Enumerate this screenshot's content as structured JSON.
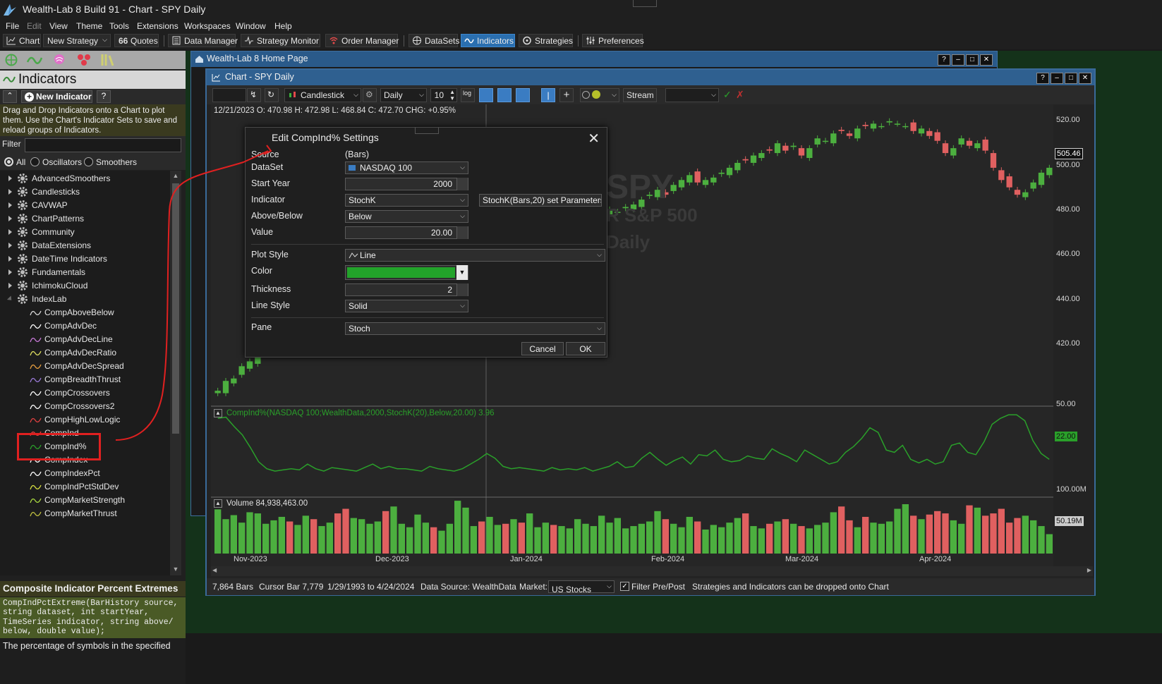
{
  "app": {
    "title": "Wealth-Lab 8 Build 91 - Chart - SPY Daily"
  },
  "menu": [
    "File",
    "Edit",
    "View",
    "Theme",
    "Tools",
    "Extensions",
    "Workspaces",
    "Window",
    "Help"
  ],
  "toolbar": {
    "chart": "Chart",
    "new_strategy": "New Strategy",
    "quotes": "Quotes",
    "data_manager": "Data Manager",
    "strategy_monitor": "Strategy Monitor",
    "order_manager": "Order Manager",
    "datasets": "DataSets",
    "indicators": "Indicators",
    "strategies": "Strategies",
    "preferences": "Preferences"
  },
  "left": {
    "title": "Indicators",
    "new_indicator": "New Indicator",
    "help_btn": "?",
    "help_text": "Drag and Drop Indicators onto a Chart to plot them. Use the Chart's Indicator Sets to save and reload groups of Indicators.",
    "filter_label": "Filter",
    "radios": [
      "All",
      "Oscillators",
      "Smoothers"
    ],
    "groups": [
      "AdvancedSmoothers",
      "Candlesticks",
      "CAVWAP",
      "ChartPatterns",
      "Community",
      "DataExtensions",
      "DateTime Indicators",
      "Fundamentals",
      "IchimokuCloud",
      "IndexLab"
    ],
    "children": [
      "CompAboveBelow",
      "CompAdvDec",
      "CompAdvDecLine",
      "CompAdvDecRatio",
      "CompAdvDecSpread",
      "CompBreadthThrust",
      "CompCrossovers",
      "CompCrossovers2",
      "CompHighLowLogic",
      "CompInd",
      "CompInd%",
      "CompIndex",
      "CompIndexPct",
      "CompIndPctStdDev",
      "CompMarketStrength",
      "CompMarketThrust"
    ],
    "child_colors": [
      "#d8d8d8",
      "#ffffff",
      "#c879d8",
      "#e0e060",
      "#e8a040",
      "#9a7ad8",
      "#ffffff",
      "#ffffff",
      "#e04040",
      "#e04040",
      "#2aa02a",
      "#ffffff",
      "#ffffff",
      "#d8e040",
      "#a8d840",
      "#c0c040"
    ],
    "desc_title": "Composite Indicator Percent Extremes",
    "desc_sig": "CompIndPctExtreme(BarHistory source,\nstring dataset, int startYear,\nTimeSeries indicator, string above/\nbelow, double value);",
    "desc_text": "The percentage of symbols in the specified"
  },
  "home": {
    "title": "Wealth-Lab 8 Home Page",
    "help": "?"
  },
  "chart": {
    "title": "Chart - SPY Daily",
    "help": "?",
    "style": "Candlestick",
    "scale": "Daily",
    "bars": "10",
    "stream": "Stream",
    "ohlc": "12/21/2023 O: 470.98 H: 472.98 L: 468.84 C: 472.70 CHG: +0.95%",
    "watermark_sym": "SPY",
    "watermark_name": "R S&P 500",
    "watermark_scale": "Daily",
    "price_ticks": [
      "520.00",
      "500.00",
      "480.00",
      "460.00",
      "440.00",
      "420.00"
    ],
    "last_price": "505.46",
    "ind_legend": "CompInd%(NASDAQ 100;WealthData,2000,StochK(20),Below,20.00) 3.96",
    "ind_tick": "50.00",
    "ind_last": "22.00",
    "vol_legend": "Volume 84,938,463.00",
    "vol_tick": "100.00M",
    "vol_last": "50.19M",
    "dates": [
      "Nov-2023",
      "Dec-2023",
      "Jan-2024",
      "Feb-2024",
      "Mar-2024",
      "Apr-2024"
    ],
    "status": {
      "bars": "7,864 Bars",
      "cursor": "Cursor Bar 7,779",
      "range": "1/29/1993 to 4/24/2024",
      "source": "Data Source: WealthData",
      "market_label": "Market:",
      "market": "US Stocks",
      "filter": "Filter Pre/Post",
      "hint": "Strategies and Indicators can be dropped onto Chart"
    }
  },
  "dialog": {
    "title": "Edit CompInd% Settings",
    "source_label": "Source",
    "source": "(Bars)",
    "dataset_label": "DataSet",
    "dataset": "NASDAQ 100",
    "start_label": "Start Year",
    "start": "2000",
    "indicator_label": "Indicator",
    "indicator": "StochK",
    "indicator_params": "StochK(Bars,20) set Parameters ...",
    "ab_label": "Above/Below",
    "ab": "Below",
    "value_label": "Value",
    "value": "20.00",
    "plot_label": "Plot Style",
    "plot": "Line",
    "color_label": "Color",
    "color": "#22a32a",
    "thick_label": "Thickness",
    "thick": "2",
    "ls_label": "Line Style",
    "ls": "Solid",
    "pane_label": "Pane",
    "pane": "Stoch",
    "cancel": "Cancel",
    "ok": "OK"
  },
  "chart_data": {
    "type": "candlestick",
    "symbol": "SPY",
    "dates": [
      "Nov-2023",
      "Dec-2023",
      "Jan-2024",
      "Feb-2024",
      "Mar-2024",
      "Apr-2024"
    ],
    "ylim": [
      410,
      528
    ],
    "close": [
      414,
      418,
      419,
      424,
      426,
      432,
      437,
      438,
      441,
      440,
      444,
      450,
      451,
      454,
      455,
      456,
      454,
      457,
      459,
      460,
      459,
      458,
      460,
      463,
      466,
      470,
      472,
      470,
      472,
      473,
      475,
      476,
      475,
      474,
      475,
      476,
      470,
      470,
      468,
      472,
      474,
      475,
      474,
      476,
      480,
      485,
      484,
      485,
      487,
      488,
      487,
      489,
      490,
      492,
      494,
      496,
      494,
      498,
      500,
      502,
      499,
      500,
      501,
      503,
      505,
      507,
      508,
      510,
      511,
      512,
      515,
      512,
      514,
      510,
      513,
      517,
      516,
      519,
      520,
      518,
      521,
      522,
      523,
      522,
      524,
      523,
      522,
      520,
      521,
      518,
      516,
      511,
      513,
      517,
      514,
      515,
      512,
      505,
      500,
      497,
      494,
      495,
      499,
      503,
      505
    ],
    "volume": [
      95,
      78,
      85,
      72,
      90,
      88,
      70,
      76,
      82,
      74,
      68,
      84,
      78,
      66,
      72,
      88,
      96,
      80,
      78,
      70,
      74,
      92,
      100,
      70,
      64,
      86,
      72,
      64,
      58,
      70,
      110,
      98,
      66,
      74,
      82,
      68,
      70,
      78,
      72,
      88,
      64,
      72,
      68,
      66,
      62,
      78,
      70,
      66,
      84,
      72,
      80,
      62,
      66,
      70,
      74,
      92,
      78,
      70,
      64,
      82,
      74,
      60,
      68,
      64,
      72,
      80,
      88,
      66,
      62,
      70,
      74,
      78,
      70,
      66,
      62,
      68,
      72,
      90,
      100,
      76,
      64,
      82,
      72,
      70,
      74,
      96,
      104,
      84,
      78,
      86,
      92,
      88,
      76,
      70,
      102,
      98,
      84,
      88,
      96,
      72,
      80,
      84,
      76,
      66,
      52
    ],
    "ind": [
      57,
      58,
      50,
      43,
      32,
      20,
      14,
      12,
      13,
      14,
      13,
      18,
      14,
      12,
      15,
      14,
      13,
      12,
      15,
      18,
      14,
      16,
      14,
      14,
      13,
      12,
      16,
      14,
      13,
      12,
      14,
      18,
      22,
      27,
      23,
      16,
      14,
      15,
      14,
      13,
      12,
      15,
      13,
      14,
      13,
      15,
      12,
      14,
      16,
      20,
      15,
      16,
      23,
      28,
      22,
      17,
      21,
      24,
      18,
      26,
      25,
      30,
      22,
      20,
      21,
      25,
      23,
      22,
      31,
      27,
      24,
      20,
      30,
      26,
      22,
      18,
      20,
      28,
      33,
      40,
      49,
      45,
      30,
      28,
      34,
      22,
      19,
      22,
      18,
      20,
      34,
      36,
      28,
      26,
      37,
      52,
      57,
      60,
      60,
      55,
      38,
      27,
      22
    ]
  }
}
